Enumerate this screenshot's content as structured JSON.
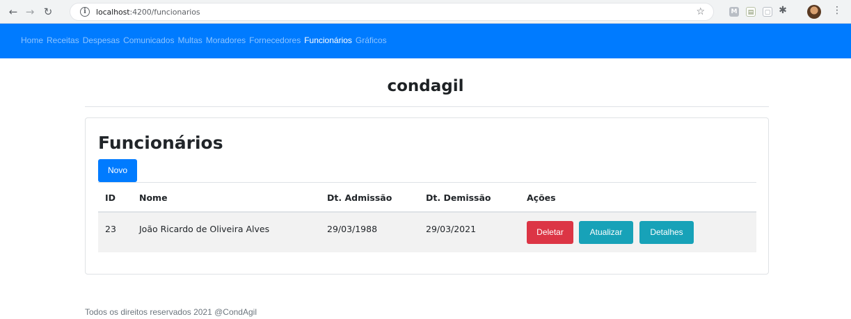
{
  "browser": {
    "url_host": "localhost",
    "url_rest": ":4200/funcionarios"
  },
  "nav": {
    "items": [
      "Home",
      "Receitas",
      "Despesas",
      "Comunicados",
      "Multas",
      "Moradores",
      "Fornecedores",
      "Funcionários",
      "Gráficos"
    ],
    "active": "Funcionários"
  },
  "brand": "condagil",
  "page": {
    "title": "Funcionários",
    "new_button": "Novo"
  },
  "table": {
    "columns": [
      "ID",
      "Nome",
      "Dt. Admissão",
      "Dt. Demissão",
      "Ações"
    ],
    "rows": [
      {
        "id": "23",
        "nome": "João Ricardo de Oliveira Alves",
        "admissao": "29/03/1988",
        "demissao": "29/03/2021",
        "actions": [
          "Deletar",
          "Atualizar",
          "Detalhes"
        ]
      }
    ]
  },
  "footer": "Todos os direitos reservados 2021 @CondAgil"
}
